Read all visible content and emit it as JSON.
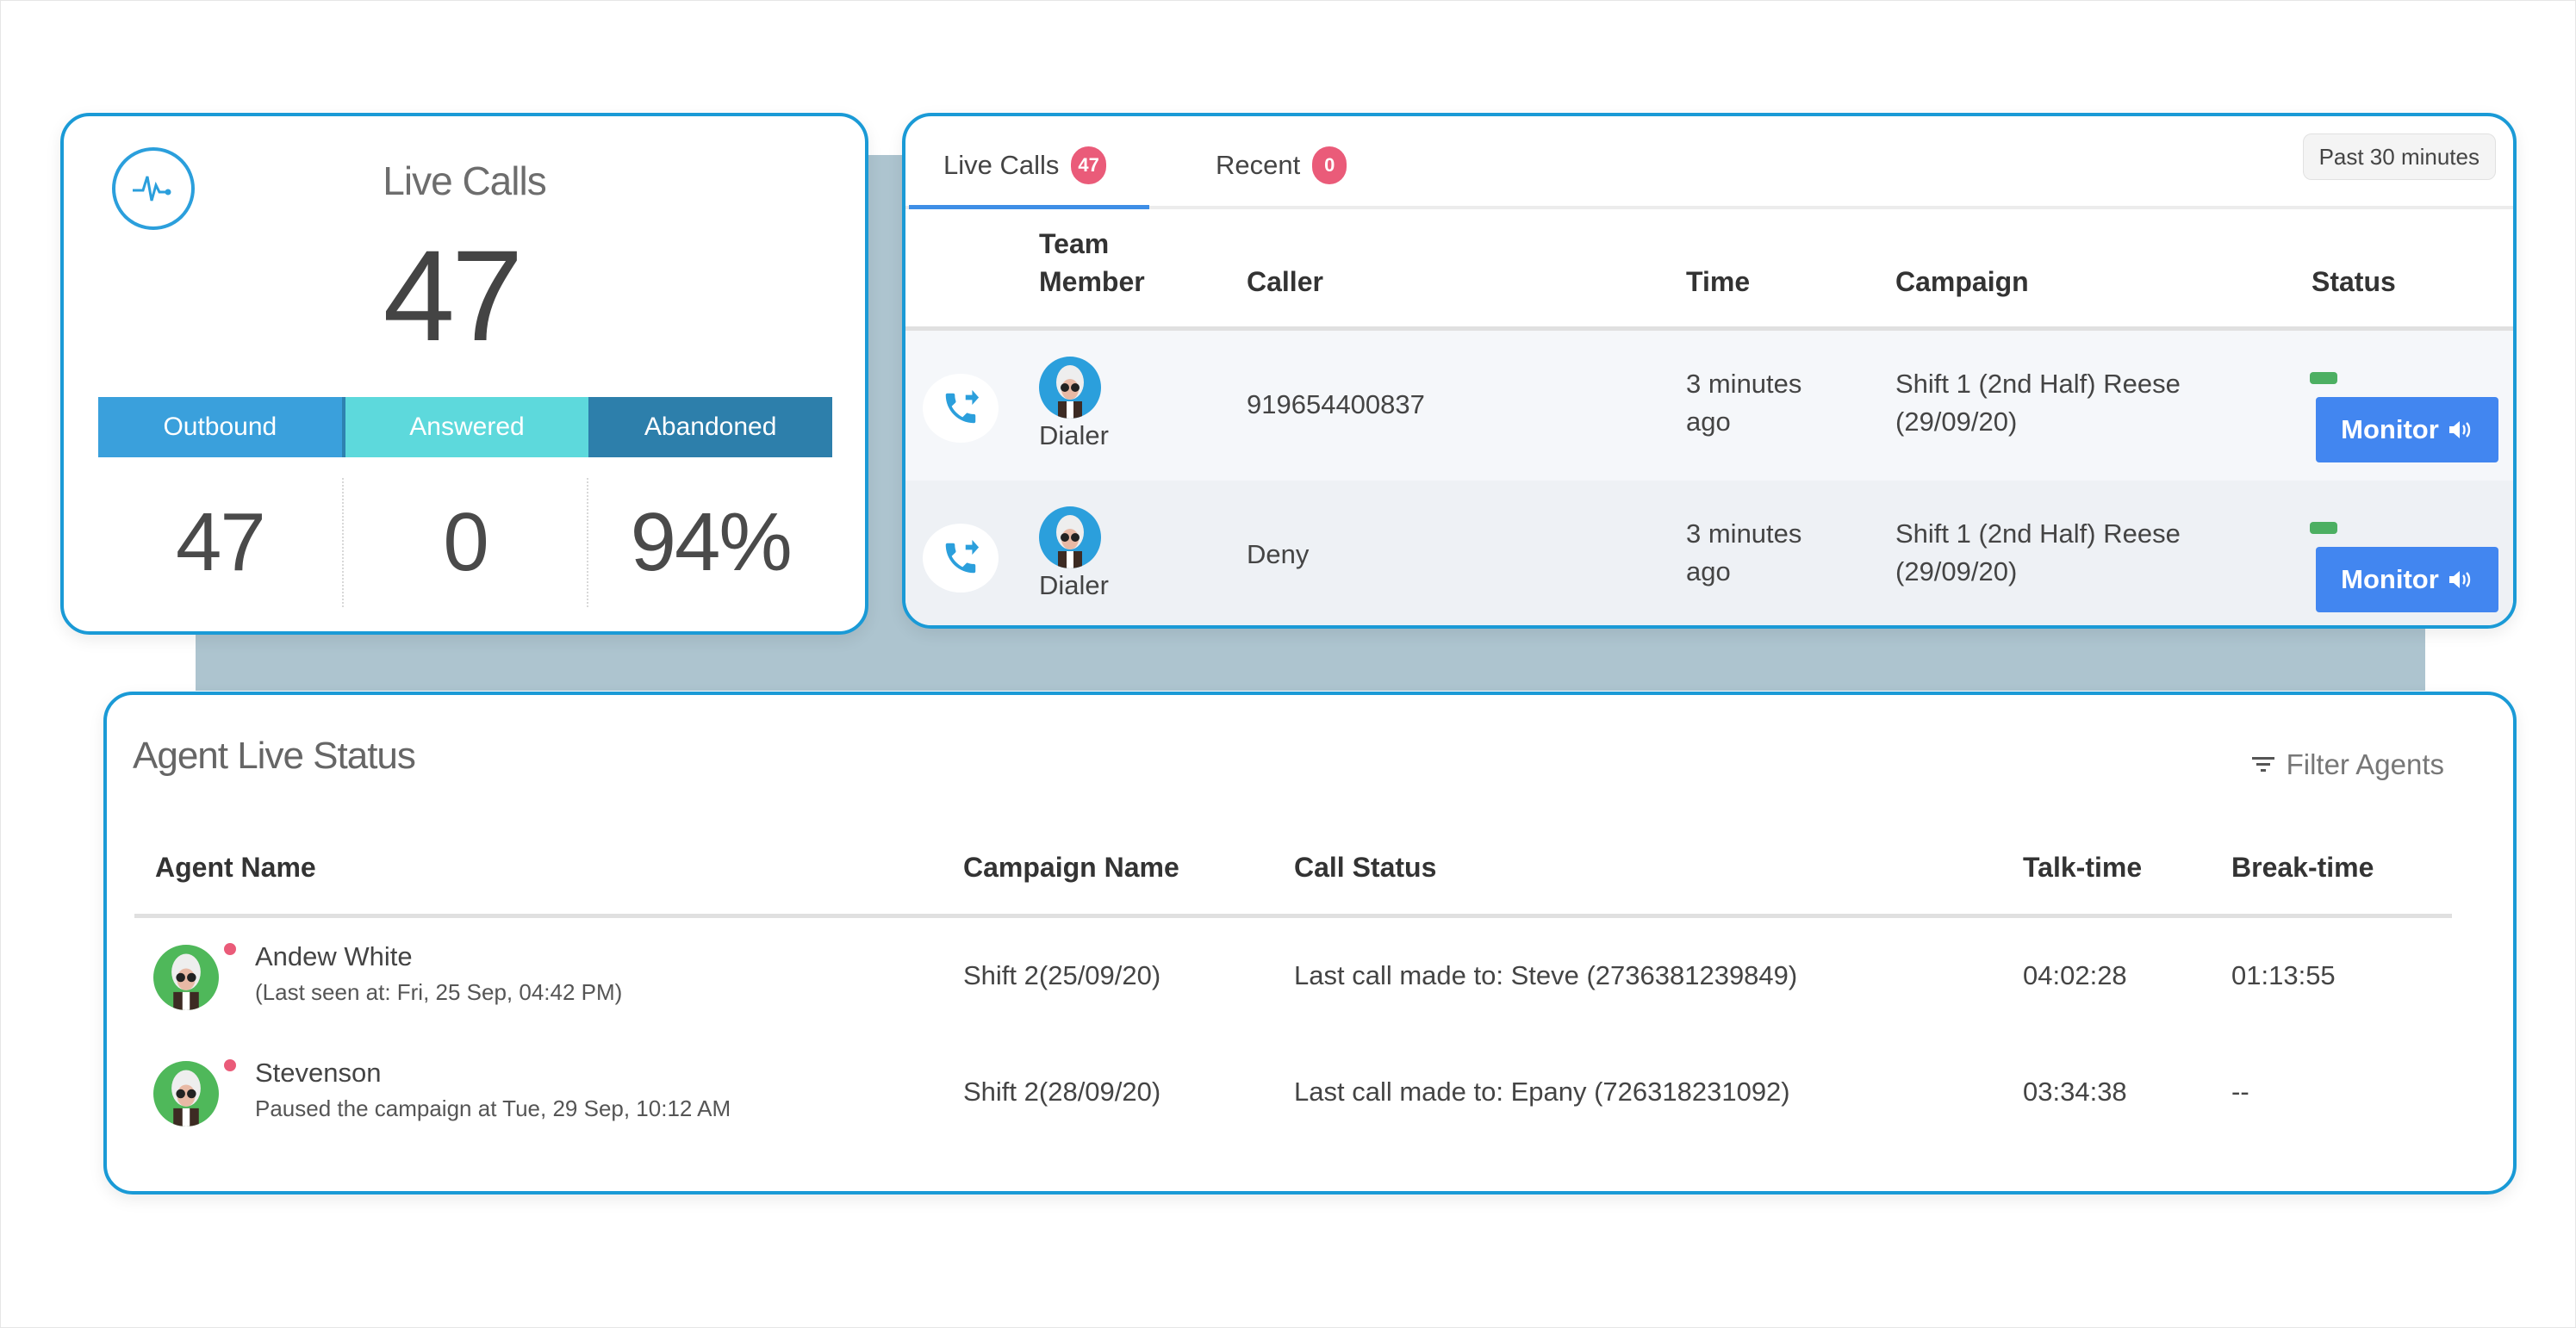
{
  "summary": {
    "title": "Live Calls",
    "total": "47",
    "icon": "pulse-icon",
    "legend": [
      {
        "label": "Outbound",
        "color": "#3aa0dc"
      },
      {
        "label": "Answered",
        "color": "#5dd9dc"
      },
      {
        "label": "Abandoned",
        "color": "#2d7fab"
      }
    ],
    "stats": [
      {
        "name": "outbound",
        "value": "47"
      },
      {
        "name": "answered",
        "value": "0"
      },
      {
        "name": "abandoned",
        "value": "94%"
      }
    ]
  },
  "live_calls": {
    "tabs": [
      {
        "label": "Live Calls",
        "count": "47",
        "active": true
      },
      {
        "label": "Recent",
        "count": "0",
        "active": false
      }
    ],
    "time_range": "Past 30 minutes",
    "columns": [
      "Team Member",
      "Caller",
      "Time",
      "Campaign",
      "Status"
    ],
    "rows": [
      {
        "direction_icon": "outgoing-call-icon",
        "member": "Dialer",
        "caller": "919654400837",
        "time": "3 minutes ago",
        "campaign": "Shift 1 (2nd Half) Reese (29/09/20)",
        "status_color": "#4caf62",
        "action": "Monitor"
      },
      {
        "direction_icon": "outgoing-call-icon",
        "member": "Dialer",
        "caller": "Deny",
        "time": "3 minutes ago",
        "campaign": "Shift 1 (2nd Half) Reese (29/09/20)",
        "status_color": "#4caf62",
        "action": "Monitor"
      }
    ]
  },
  "agents": {
    "title": "Agent Live Status",
    "filter_label": "Filter Agents",
    "columns": [
      "Agent Name",
      "Campaign Name",
      "Call Status",
      "Talk-time",
      "Break-time"
    ],
    "rows": [
      {
        "name": "Andew White",
        "subtitle": "(Last seen at: Fri, 25 Sep, 04:42 PM)",
        "campaign": "Shift 2(25/09/20)",
        "call_status": "Last call made to: Steve (2736381239849)",
        "talk_time": "04:02:28",
        "break_time": "01:13:55"
      },
      {
        "name": "Stevenson",
        "subtitle": "Paused the campaign at Tue, 29 Sep, 10:12 AM",
        "campaign": "Shift 2(28/09/20)",
        "call_status": "Last call made to: Epany (726318231092)",
        "talk_time": "03:34:38",
        "break_time": "--"
      }
    ]
  },
  "colors": {
    "panel_border": "#1a9ad6",
    "badge": "#ea5b79",
    "monitor_button": "#4286f0",
    "status_active": "#4caf62",
    "backdrop": "#adc4cf"
  }
}
